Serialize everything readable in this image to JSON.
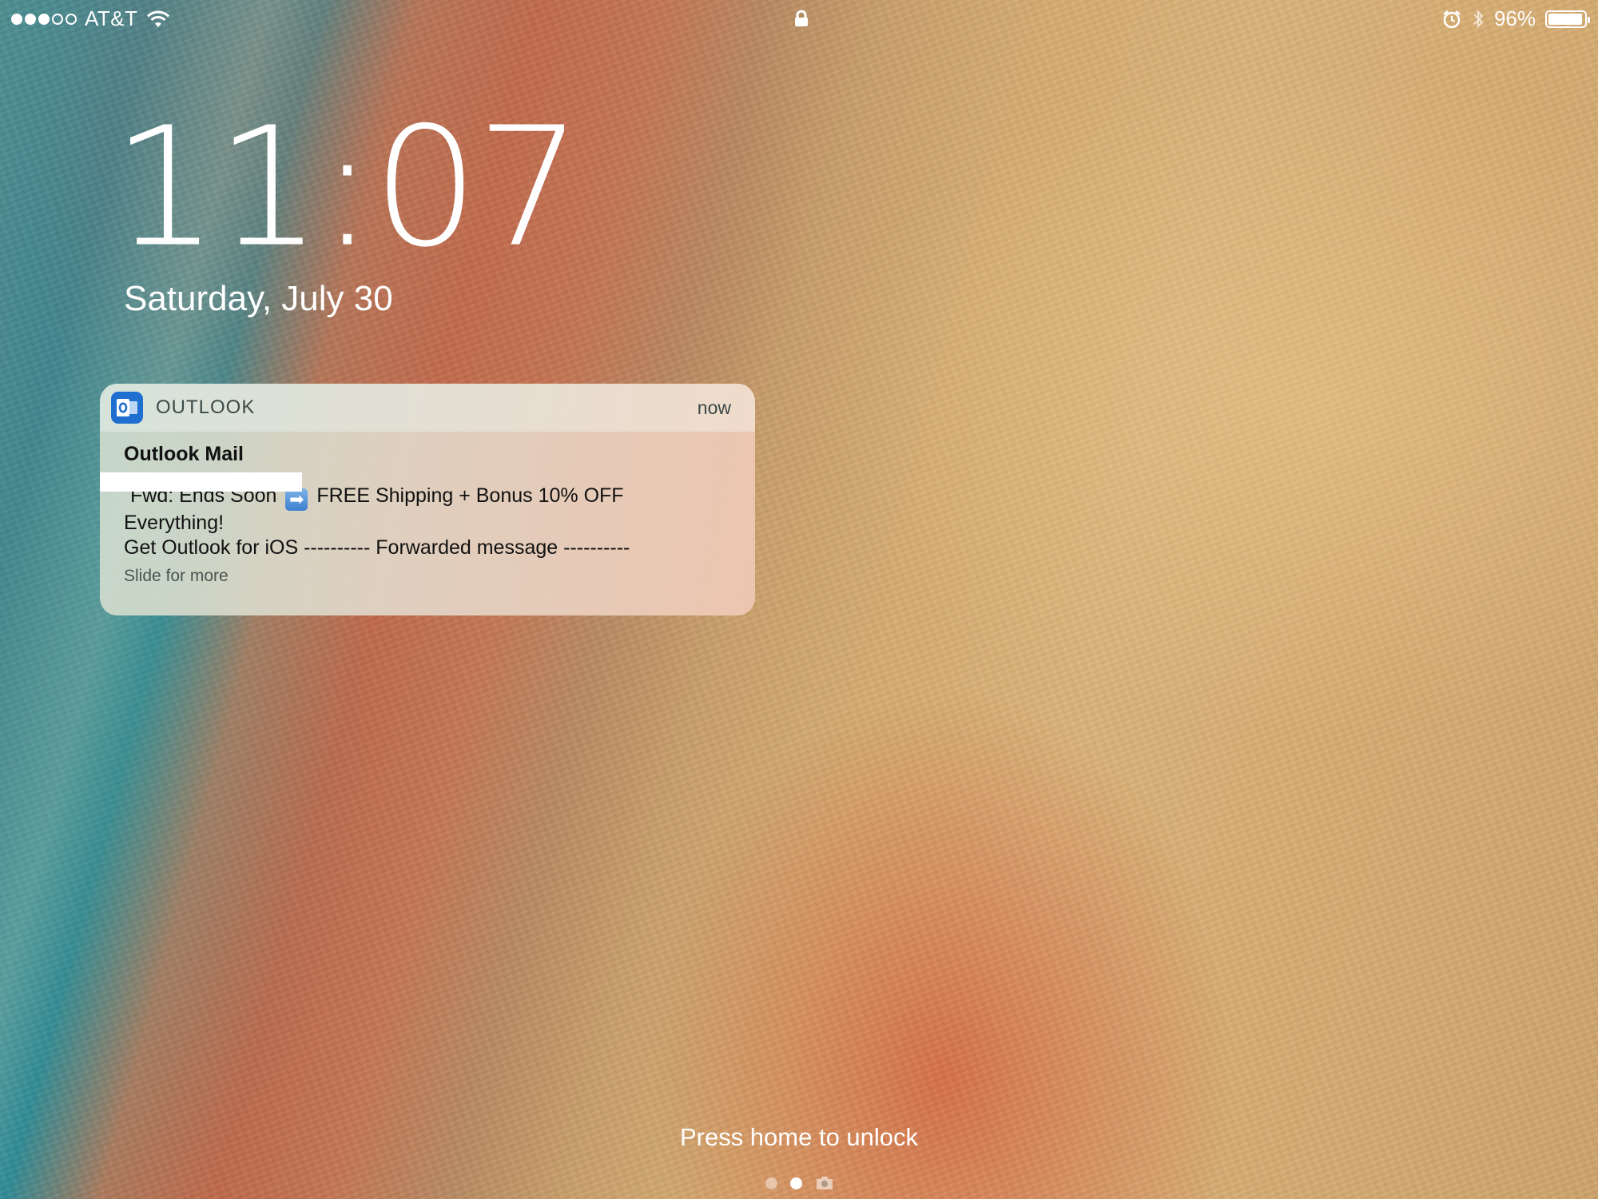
{
  "status_bar": {
    "carrier": "AT&T",
    "signal_bars_total": 5,
    "signal_bars_filled": 3,
    "battery_percent": "96%",
    "battery_level": 0.96
  },
  "lock_screen": {
    "time": "11:07",
    "date": "Saturday, July 30",
    "unlock_hint": "Press home to unlock"
  },
  "notification": {
    "app_name": "OUTLOOK",
    "time": "now",
    "title": "Outlook Mail",
    "subject_prefix": "Fwd: Ends Soon",
    "subject_suffix": "FREE Shipping + Bonus 10% OFF",
    "subject_line2": "Everything!",
    "preview": "Get Outlook for iOS ---------- Forwarded message ----------",
    "slide_hint": "Slide for more",
    "app_color": "#1e6fd0"
  },
  "pager": {
    "pages": 3,
    "active_index": 1
  }
}
